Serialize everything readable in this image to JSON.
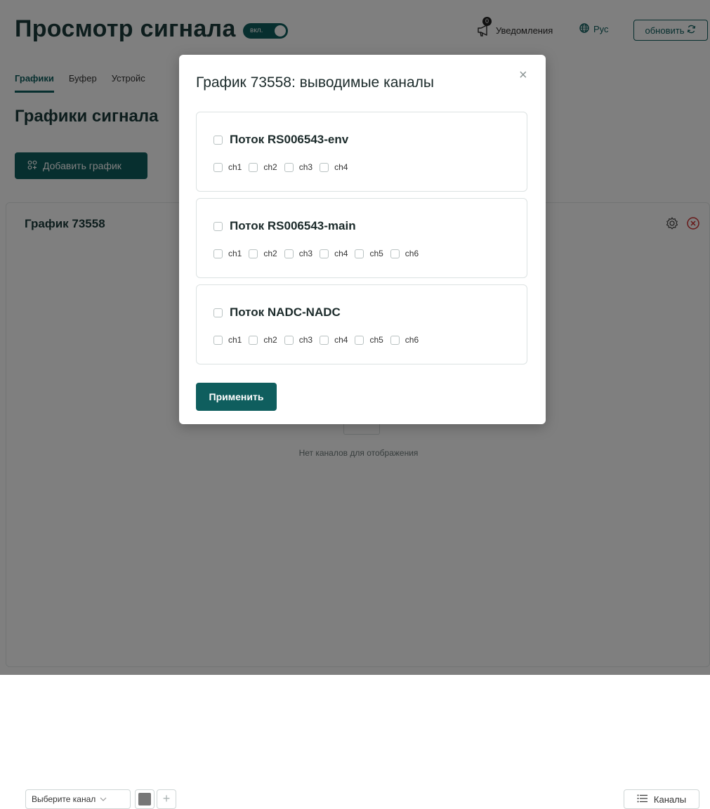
{
  "header": {
    "title": "Просмотр сигнала",
    "toggle_label": "вкл.",
    "notifications_count": "0",
    "notifications_label": "Уведомления",
    "language_label": "Рус",
    "refresh_label": "обновить"
  },
  "tabs": [
    {
      "label": "Графики",
      "active": true
    },
    {
      "label": "Буфер",
      "active": false
    },
    {
      "label": "Устройс",
      "active": false
    }
  ],
  "section": {
    "title": "Графики сигнала",
    "add_button_label": "Добавить график"
  },
  "chart_card": {
    "title": "График 73558",
    "empty_text": "Нет каналов для отображения",
    "channel_select_placeholder": "Выберите канал",
    "channels_button_label": "Каналы"
  },
  "modal": {
    "title": "График 73558: выводимые каналы",
    "close_symbol": "×",
    "apply_label": "Применить",
    "streams": [
      {
        "name": "Поток RS006543-env",
        "channels": [
          "ch1",
          "ch2",
          "ch3",
          "ch4"
        ]
      },
      {
        "name": "Поток RS006543-main",
        "channels": [
          "ch1",
          "ch2",
          "ch3",
          "ch4",
          "ch5",
          "ch6"
        ]
      },
      {
        "name": "Поток NADC-NADC",
        "channels": [
          "ch1",
          "ch2",
          "ch3",
          "ch4",
          "ch5",
          "ch6"
        ]
      }
    ]
  },
  "colors": {
    "accent": "#0f5e5e",
    "overlay": "rgba(0,0,0,0.5)"
  }
}
